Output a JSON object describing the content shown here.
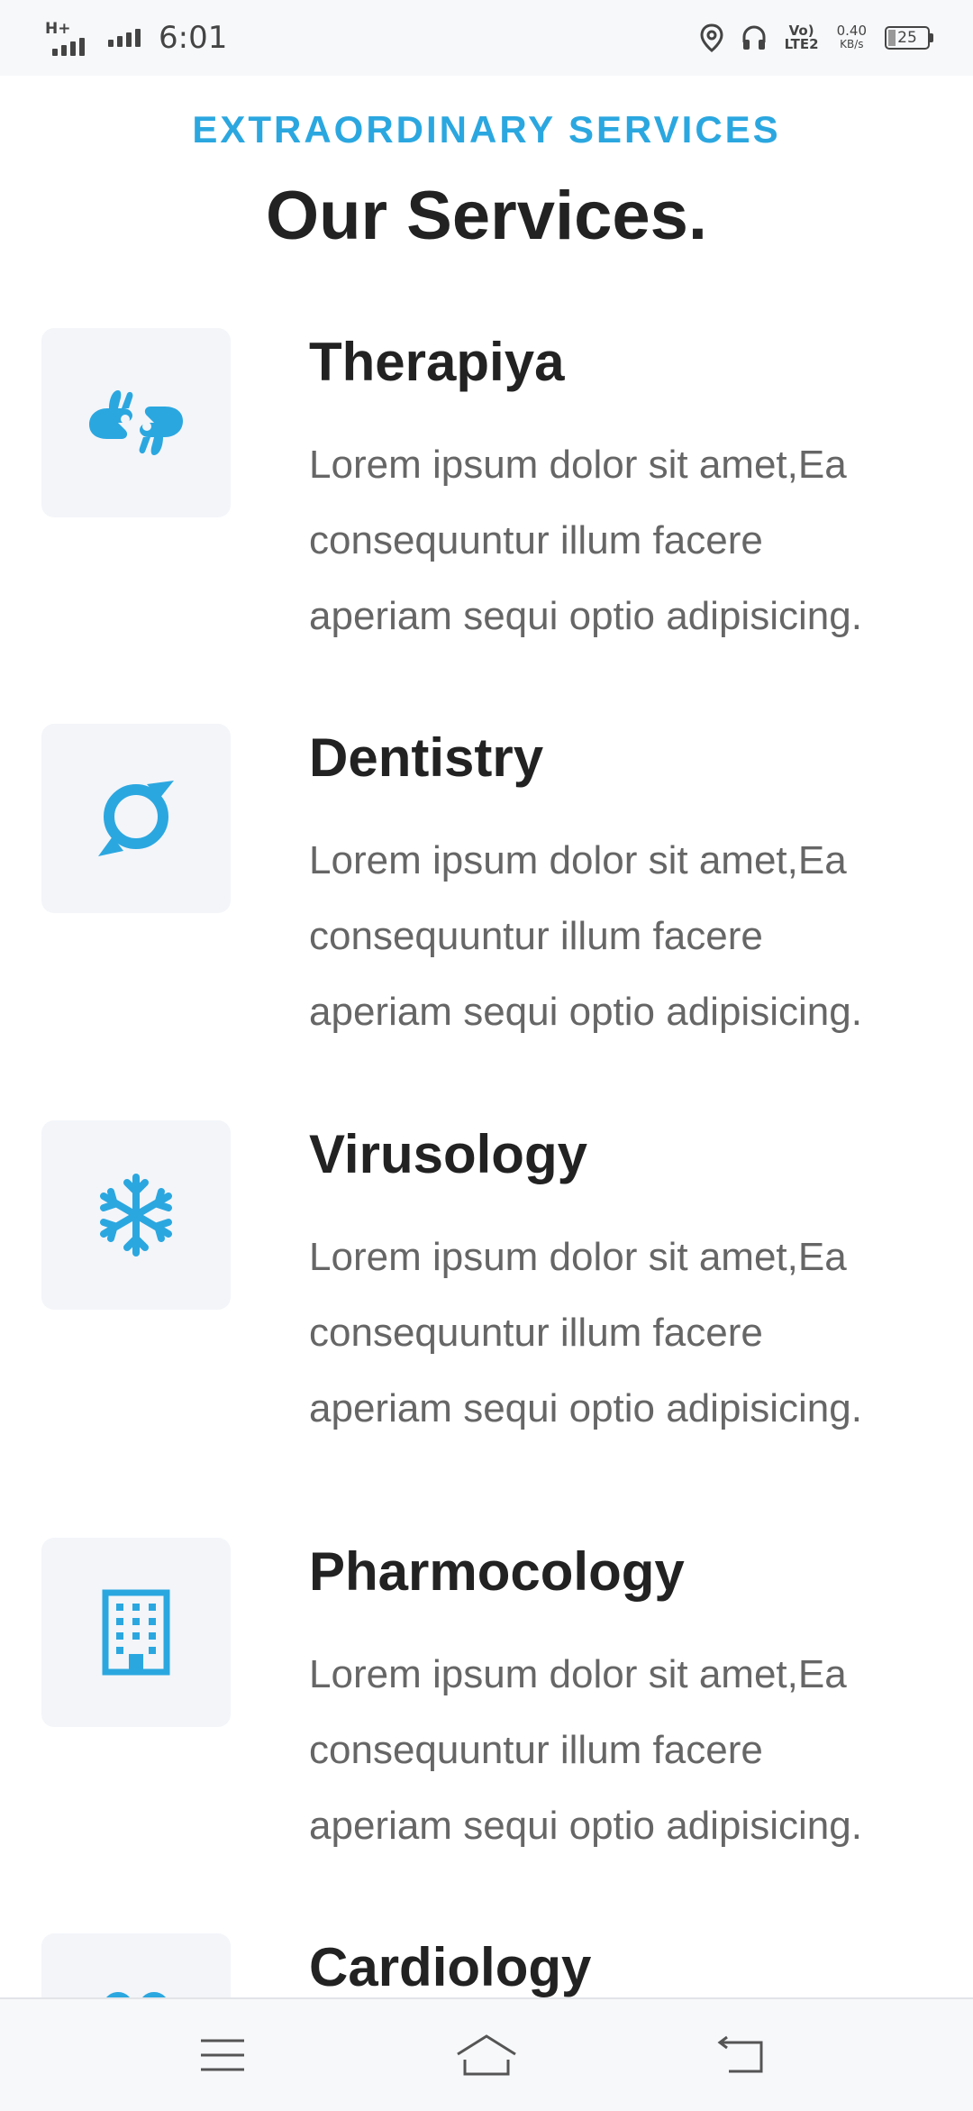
{
  "status_bar": {
    "network_type": "H+",
    "time": "6:01",
    "volte_top": "Vo)",
    "volte_bottom": "LTE2",
    "speed_value": "0.40",
    "speed_unit": "KB/s",
    "battery": "25",
    "icons": [
      "location-icon",
      "headphones-icon"
    ]
  },
  "header": {
    "eyebrow": "EXTRAORDINARY SERVICES",
    "title": "Our Services."
  },
  "services": [
    {
      "title": "Therapiya",
      "icon": "sign-language-hands-icon",
      "lines": [
        "Lorem ipsum dolor sit amet,Ea",
        "consequuntur illum facere",
        "aperiam sequi optio adipisicing."
      ]
    },
    {
      "title": "Dentistry",
      "icon": "chat-bubble-ring-icon",
      "lines": [
        "Lorem ipsum dolor sit amet,Ea",
        "consequuntur illum facere",
        "aperiam sequi optio adipisicing."
      ]
    },
    {
      "title": "Virusology",
      "icon": "snowflake-icon",
      "lines": [
        "Lorem ipsum dolor sit amet,Ea",
        "consequuntur illum facere",
        "aperiam sequi optio adipisicing."
      ]
    },
    {
      "title": "Pharmocology",
      "icon": "building-icon",
      "lines": [
        "Lorem ipsum dolor sit amet,Ea",
        "consequuntur illum facere",
        "aperiam sequi optio adipisicing."
      ]
    },
    {
      "title": "Cardiology",
      "icon": "eyeglasses-icon",
      "lines": []
    }
  ],
  "colors": {
    "accent": "#2ba7e0",
    "heading": "#222222",
    "body_text": "#666666",
    "icon_bg": "#f3f5f9"
  },
  "nav": [
    "menu-icon",
    "home-icon",
    "back-icon"
  ]
}
